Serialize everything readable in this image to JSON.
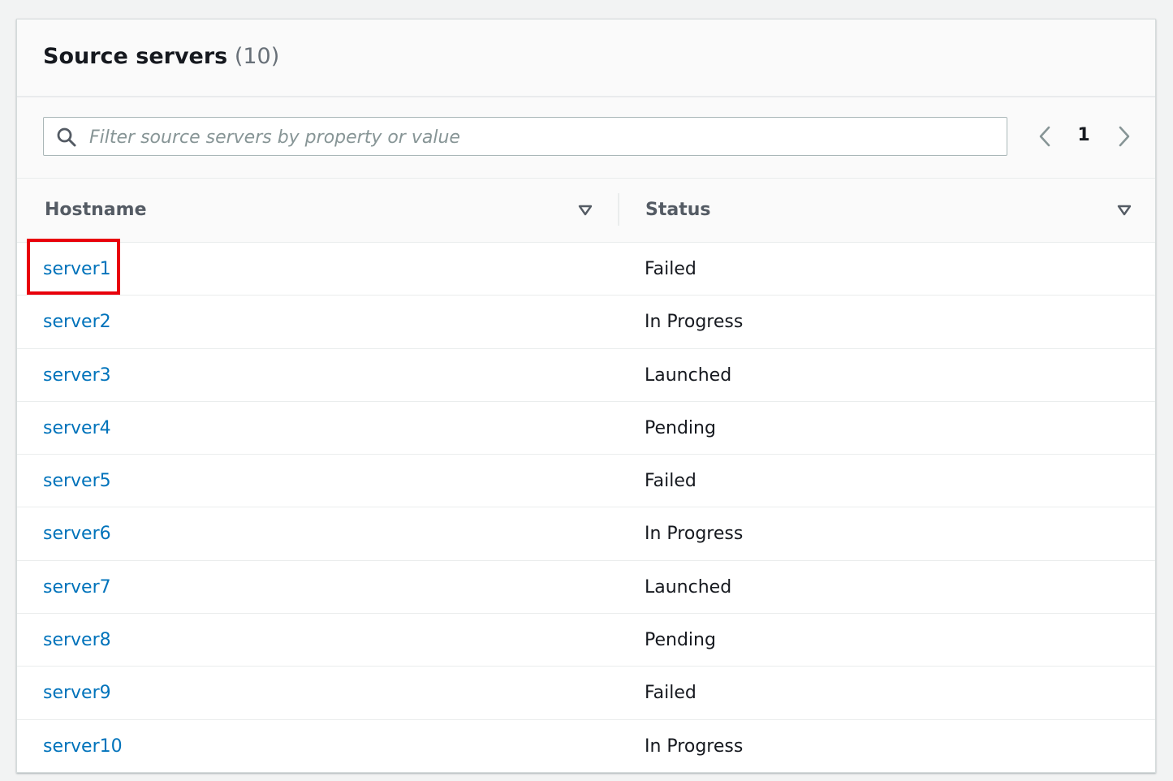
{
  "panel": {
    "title": "Source servers",
    "count": "(10)"
  },
  "filter": {
    "placeholder": "Filter source servers by property or value",
    "value": "",
    "icon": "search-icon"
  },
  "pagination": {
    "current_page": "1",
    "prev_icon": "chevron-left-icon",
    "next_icon": "chevron-right-icon"
  },
  "table": {
    "columns": [
      {
        "label": "Hostname",
        "sort_icon": "sort-caret-down-icon"
      },
      {
        "label": "Status",
        "sort_icon": "sort-caret-down-icon"
      }
    ],
    "rows": [
      {
        "hostname": "server1",
        "status": "Failed"
      },
      {
        "hostname": "server2",
        "status": "In Progress"
      },
      {
        "hostname": "server3",
        "status": "Launched"
      },
      {
        "hostname": "server4",
        "status": "Pending"
      },
      {
        "hostname": "server5",
        "status": "Failed"
      },
      {
        "hostname": "server6",
        "status": "In Progress"
      },
      {
        "hostname": "server7",
        "status": "Launched"
      },
      {
        "hostname": "server8",
        "status": "Pending"
      },
      {
        "hostname": "server9",
        "status": "Failed"
      },
      {
        "hostname": "server10",
        "status": "In Progress"
      }
    ]
  },
  "colors": {
    "link": "#0073bb",
    "text": "#16191f",
    "header_text": "#545b64",
    "highlight": "#e8000b"
  }
}
